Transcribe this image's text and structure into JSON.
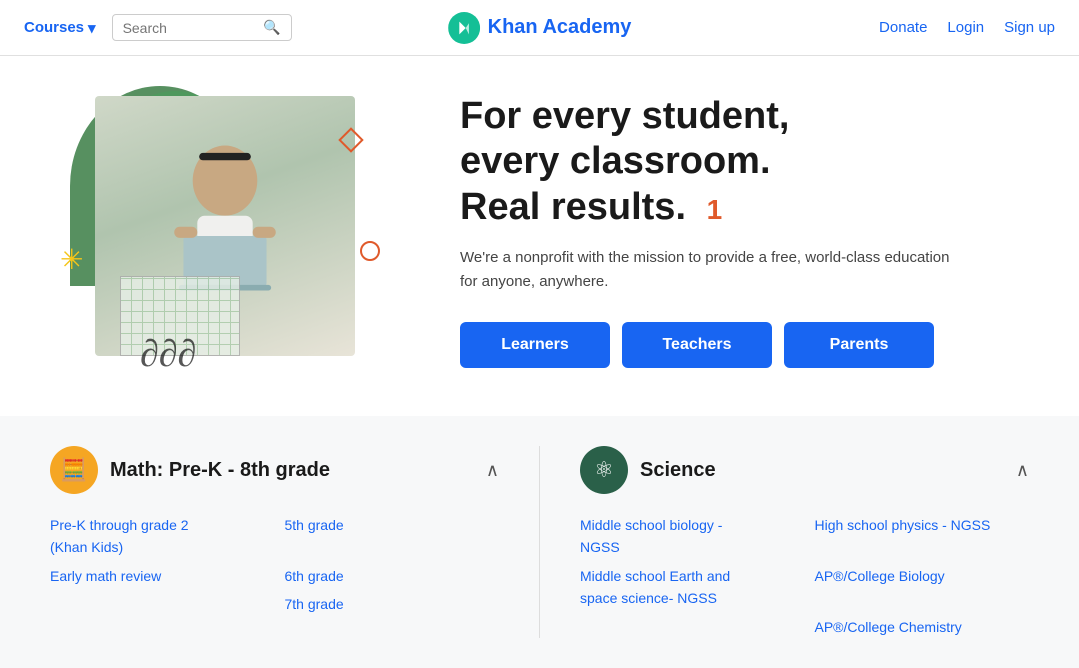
{
  "nav": {
    "courses_label": "Courses",
    "search_placeholder": "Search",
    "logo_text": "Khan Academy",
    "donate_label": "Donate",
    "login_label": "Login",
    "signup_label": "Sign up"
  },
  "hero": {
    "title_line1": "For every student,",
    "title_line2": "every classroom.",
    "title_line3": "Real results.",
    "counter": "1",
    "subtitle": "We're a nonprofit with the mission to provide a free, world-class education for anyone, anywhere.",
    "btn_learners": "Learners",
    "btn_teachers": "Teachers",
    "btn_parents": "Parents"
  },
  "courses": {
    "math": {
      "icon": "🧮",
      "title": "Math: Pre-K - 8th grade",
      "links": [
        "Pre-K through grade 2\n(Khan Kids)",
        "5th grade",
        "Early math review",
        "6th grade",
        "",
        "7th grade"
      ]
    },
    "science": {
      "icon": "⚛",
      "title": "Science",
      "links": [
        "Middle school biology -\nNGSS",
        "High school physics - NGSS",
        "Middle school Earth and\nspace science- NGSS",
        "AP®/College Biology",
        "",
        "AP®/College Chemistry"
      ]
    }
  }
}
